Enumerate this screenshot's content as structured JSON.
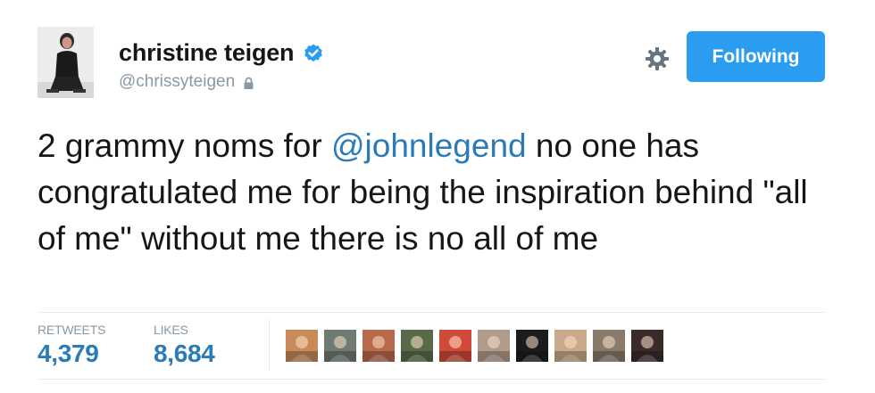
{
  "user": {
    "display_name": "christine teigen",
    "handle": "@chrissyteigen",
    "avatar_icon": "user-avatar-photo",
    "verified_icon": "verified-badge-icon",
    "protected_icon": "lock-icon"
  },
  "actions": {
    "settings_icon": "gear-icon",
    "follow_label": "Following"
  },
  "tweet": {
    "text_before": "2 grammy noms for ",
    "mention": "@johnlegend",
    "text_after": " no one has congratulated me for being the inspiration behind \"all of me\" without me there is no all of me"
  },
  "stats": {
    "retweets_label": "RETWEETS",
    "retweets_value": "4,379",
    "likes_label": "LIKES",
    "likes_value": "8,684"
  },
  "liked_by": {
    "count_shown": 10,
    "avatar_colors": [
      "#c98a5a",
      "#6f7a70",
      "#b86a4a",
      "#5a6a48",
      "#d04a3a",
      "#b09a8a",
      "#1c1c1c",
      "#c9a98a",
      "#8a7a6a",
      "#3a2a2a"
    ]
  },
  "colors": {
    "accent": "#2b9df0",
    "link": "#2b7bb9",
    "muted": "#8899a6",
    "divider": "#e6ecf0"
  }
}
